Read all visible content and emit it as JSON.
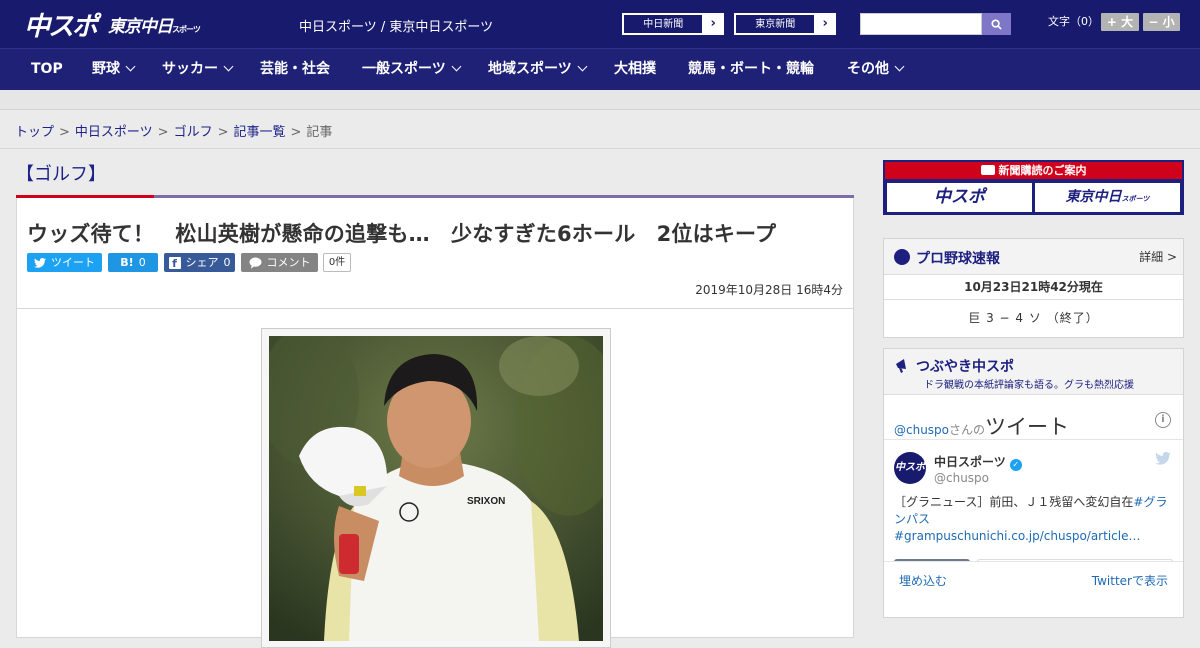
{
  "header": {
    "logo_main": "中スポ",
    "logo_sub": "東京中日",
    "logo_sub_small": "スポーツ",
    "site_name": "中日スポーツ / 東京中日スポーツ",
    "ext_links": [
      {
        "label": "中日新聞"
      },
      {
        "label": "東京新聞"
      }
    ],
    "search_placeholder": "",
    "font_size_label": "文字（0）",
    "font_larger": "+ 大",
    "font_smaller": "− 小"
  },
  "nav": {
    "items": [
      {
        "label": "TOP",
        "dropdown": false
      },
      {
        "label": "野球",
        "dropdown": true
      },
      {
        "label": "サッカー",
        "dropdown": true
      },
      {
        "label": "芸能・社会",
        "dropdown": false
      },
      {
        "label": "一般スポーツ",
        "dropdown": true
      },
      {
        "label": "地域スポーツ",
        "dropdown": true
      },
      {
        "label": "大相撲",
        "dropdown": false
      },
      {
        "label": "競馬・ボート・競輪",
        "dropdown": false
      },
      {
        "label": "その他",
        "dropdown": true
      }
    ]
  },
  "breadcrumb": {
    "items": [
      "トップ",
      "中日スポーツ",
      "ゴルフ",
      "記事一覧"
    ],
    "current": "記事",
    "separator": ">"
  },
  "article": {
    "category": "【ゴルフ】",
    "headline": "ウッズ待て！　松山英樹が懸命の追撃も…　少なすぎた6ホール　2位はキープ",
    "share": {
      "tweet": "ツイート",
      "hatena_label": "B!",
      "hatena_count": "0",
      "facebook": "シェア",
      "facebook_count": "0",
      "comment": "コメント",
      "comment_count": "0件"
    },
    "published": "2019年10月28日 16時4分"
  },
  "sidebar": {
    "subscribe": {
      "heading": "新聞購読のご案内",
      "left": "中スポ",
      "right": "東京中日",
      "right_small": "スポーツ"
    },
    "baseball": {
      "title": "プロ野球速報",
      "detail": "詳細 >",
      "timestamp": "10月23日21時42分現在",
      "score": "巨 3 − 4 ソ （終了）"
    },
    "twitter": {
      "title": "つぶやき中スポ",
      "subtitle": "ドラ観戦の本紙評論家も語る。グラも熱烈応援",
      "handle": "@chuspo",
      "handle_suffix": "さんの",
      "tweets_label": "ツイート",
      "tweet": {
        "avatar_text": "中スポ",
        "name": "中日スポーツ",
        "user_id": "@chuspo",
        "text_plain": "［グラニュース］前田、Ｊ１残留へ変幻自在",
        "text_link": "#グランパス #grampuschunichi.co.jp/chuspo/article…"
      },
      "embed": "埋め込む",
      "view_on": "Twitterで表示"
    }
  },
  "colors": {
    "header_bg": "#181a6e",
    "nav_bg": "#1f2177",
    "accent_red": "#d0021b",
    "accent_purple": "#7d6da8",
    "link_blue": "#1d2387",
    "twitter_blue": "#1da1f2",
    "facebook_blue": "#385a99"
  },
  "icons": [
    "search-icon",
    "chevron-right-icon",
    "chevron-down-icon",
    "twitter-bird-icon",
    "facebook-icon",
    "comment-icon",
    "baseball-icon",
    "megaphone-icon",
    "info-icon",
    "verified-badge-icon",
    "newspaper-icon"
  ]
}
